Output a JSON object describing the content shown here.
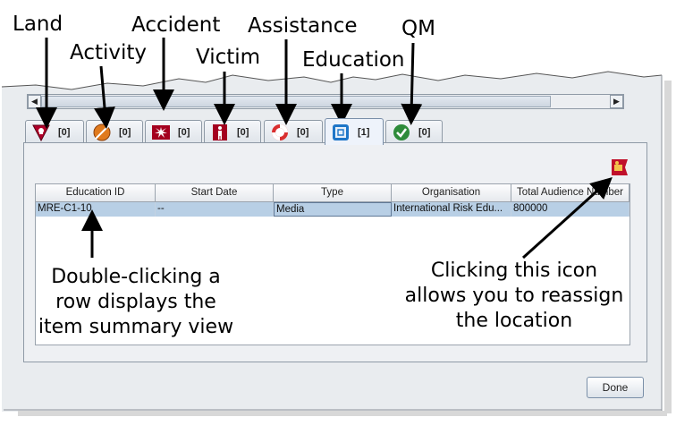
{
  "callouts": {
    "land": "Land",
    "activity": "Activity",
    "accident": "Accident",
    "victim": "Victim",
    "assistance": "Assistance",
    "education": "Education",
    "qm": "QM"
  },
  "tabs": [
    {
      "icon": "land-icon",
      "count": "[0]"
    },
    {
      "icon": "activity-icon",
      "count": "[0]"
    },
    {
      "icon": "accident-icon",
      "count": "[0]"
    },
    {
      "icon": "victim-icon",
      "count": "[0]"
    },
    {
      "icon": "assistance-icon",
      "count": "[0]"
    },
    {
      "icon": "education-icon",
      "count": "[1]",
      "active": true
    },
    {
      "icon": "qm-icon",
      "count": "[0]"
    }
  ],
  "table": {
    "headers": [
      "Education ID",
      "Start Date",
      "Type",
      "Organisation",
      "Total Audience Number"
    ],
    "rows": [
      [
        "MRE-C1-10",
        "--",
        "Media",
        "International Risk Edu...",
        "800000"
      ]
    ]
  },
  "annotations": {
    "row_line1": "Double-clicking a",
    "row_line2": "row displays the",
    "row_line3": "item summary view",
    "icon_line1": "Clicking this icon",
    "icon_line2": "allows you to reassign",
    "icon_line3": "the location"
  },
  "buttons": {
    "done": "Done"
  },
  "colors": {
    "selected_row": "#b8cfe5",
    "panel_bg": "#eef0f3"
  }
}
